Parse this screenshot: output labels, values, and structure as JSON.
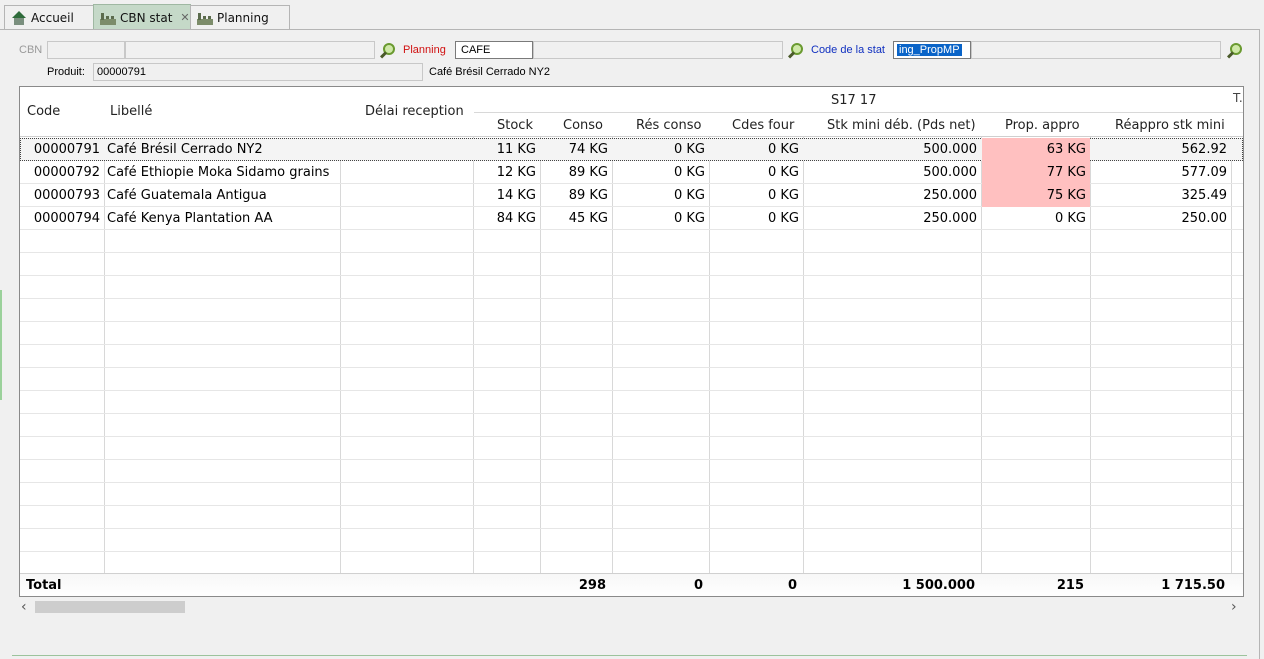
{
  "tabs": [
    {
      "label": "Accueil",
      "icon": "home-icon"
    },
    {
      "label": "CBN stat",
      "icon": "factory-icon",
      "closable": true
    },
    {
      "label": "Planning",
      "icon": "factory-icon"
    }
  ],
  "filters": {
    "cbn_label": "CBN",
    "cbn_code": "",
    "cbn_desc": "",
    "planning_label": "Planning",
    "planning_value": "CAFE",
    "planning_desc": "",
    "code_stat_label": "Code de la stat",
    "code_stat_value": "ing_PropMP",
    "code_stat_desc": "",
    "produit_label": "Produit:",
    "produit_value": "00000791",
    "produit_desc": "Café Brésil Cerrado NY2"
  },
  "grid": {
    "columns": {
      "code": "Code",
      "libelle": "Libellé",
      "delai": "Délai reception",
      "period": "S17 17",
      "stock": "Stock",
      "conso": "Conso",
      "res_conso": "Rés conso",
      "cdes_four": "Cdes four",
      "stk_mini": "Stk mini déb. (Pds net)",
      "prop_appro": "Prop. appro",
      "reappro": "Réappro stk mini",
      "next_truncated": "T."
    },
    "rows": [
      {
        "code": "00000791",
        "libelle": "Café Brésil Cerrado NY2",
        "delai": "",
        "stock": "11 KG",
        "conso": "74 KG",
        "res_conso": "0 KG",
        "cdes_four": "0 KG",
        "stk_mini": "500.000",
        "prop_appro": "63 KG",
        "reappro": "562.92"
      },
      {
        "code": "00000792",
        "libelle": "Café Ethiopie Moka Sidamo grains",
        "delai": "",
        "stock": "12 KG",
        "conso": "89 KG",
        "res_conso": "0 KG",
        "cdes_four": "0 KG",
        "stk_mini": "500.000",
        "prop_appro": "77 KG",
        "reappro": "577.09"
      },
      {
        "code": "00000793",
        "libelle": "Café Guatemala Antigua",
        "delai": "",
        "stock": "14 KG",
        "conso": "89 KG",
        "res_conso": "0 KG",
        "cdes_four": "0 KG",
        "stk_mini": "250.000",
        "prop_appro": "75 KG",
        "reappro": "325.49"
      },
      {
        "code": "00000794",
        "libelle": "Café Kenya Plantation AA",
        "delai": "",
        "stock": "84 KG",
        "conso": "45 KG",
        "res_conso": "0 KG",
        "cdes_four": "0 KG",
        "stk_mini": "250.000",
        "prop_appro": "0 KG",
        "reappro": "250.00"
      }
    ],
    "totals": {
      "label": "Total",
      "stock": "",
      "conso": "298",
      "res_conso": "0",
      "cdes_four": "0",
      "stk_mini": "1 500.000",
      "prop_appro": "215",
      "reappro": "1 715.50"
    }
  },
  "colors": {
    "highlight": "#ffc0c0",
    "active_tab": "#c5d9c8",
    "selection": "#0a64c8"
  }
}
